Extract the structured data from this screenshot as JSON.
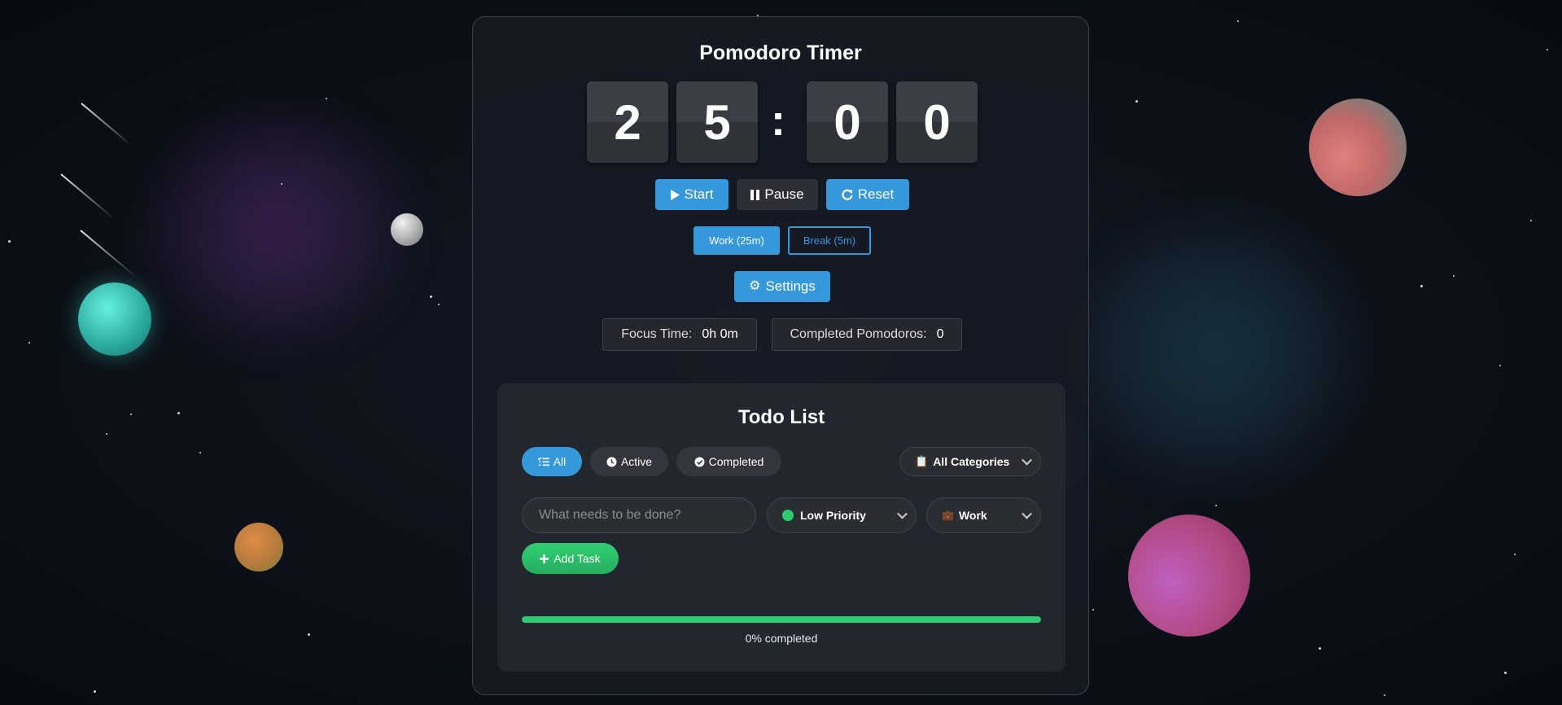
{
  "timer": {
    "title": "Pomodoro Timer",
    "digits": [
      "2",
      "5",
      "0",
      "0"
    ],
    "separator": ":",
    "controls": {
      "start": "Start",
      "pause": "Pause",
      "reset": "Reset"
    },
    "modes": {
      "work": "Work (25m)",
      "break": "Break (5m)",
      "active": "work"
    },
    "settings": "Settings",
    "stats": {
      "focus_label": "Focus Time:",
      "focus_value": "0h 0m",
      "completed_label": "Completed Pomodoros:",
      "completed_value": "0"
    }
  },
  "todo": {
    "title": "Todo List",
    "filters": [
      "All",
      "Active",
      "Completed"
    ],
    "active_filter": "All",
    "category_filter": "All Categories",
    "input_placeholder": "What needs to be done?",
    "priority": "Low Priority",
    "category": "Work",
    "add_button": "Add Task",
    "progress_percent": 100,
    "progress_text": "0% completed"
  },
  "colors": {
    "accent": "#3498db",
    "success": "#2ecc71"
  },
  "icons": {
    "start": "play-icon",
    "pause": "pause-icon",
    "reset": "redo-icon",
    "settings": "gear-icon",
    "all": "list-check-icon",
    "active": "clock-icon",
    "completed": "check-circle-icon",
    "categories": "clipboard-icon",
    "work": "briefcase-icon",
    "add": "plus-icon"
  }
}
